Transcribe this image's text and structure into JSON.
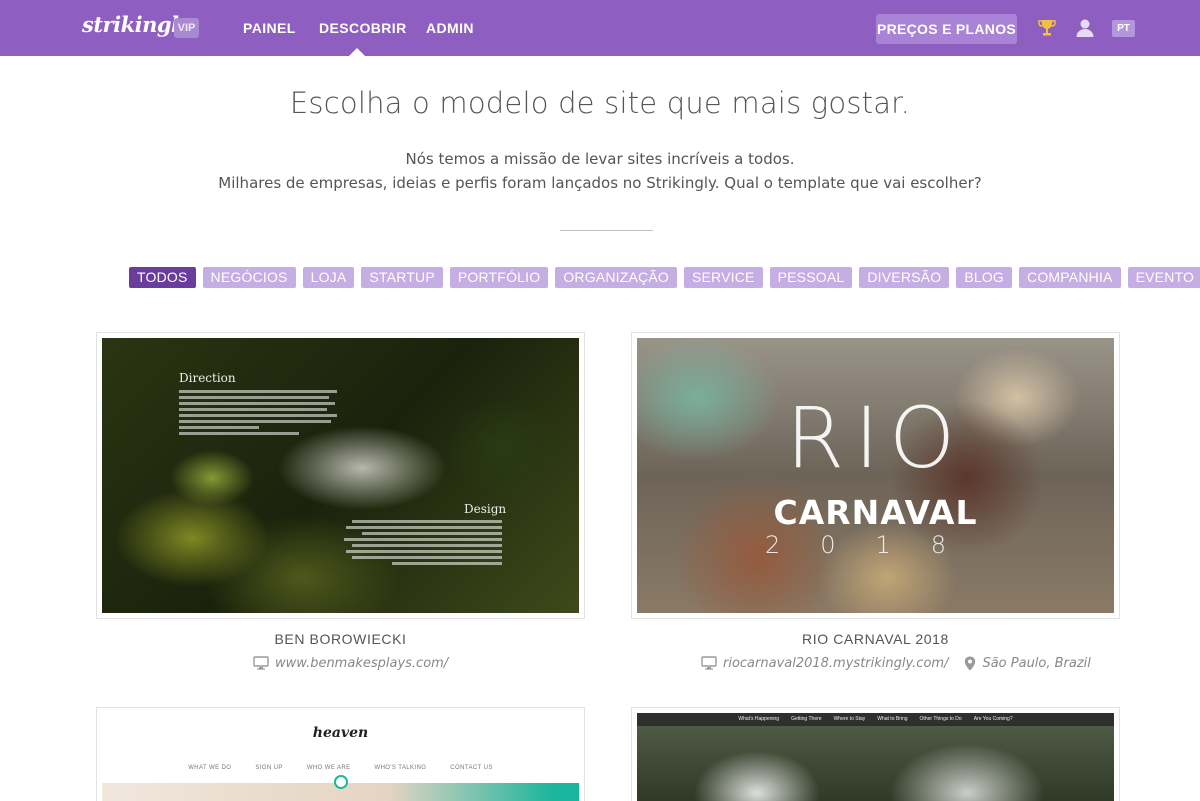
{
  "nav": {
    "logo": "strikingly",
    "vip": "VIP",
    "links": [
      "PAINEL",
      "DESCOBRIR",
      "ADMIN"
    ],
    "active_link": "DESCOBRIR",
    "plans_button": "PREÇOS E PLANOS",
    "trophy_icon": "trophy-icon",
    "user_icon": "user-icon",
    "lang": "PT",
    "trophy_color": "#f3c33c"
  },
  "hero": {
    "headline": "Escolha o modelo de site que mais gostar.",
    "sub_line_1": "Nós temos a missão de levar sites incríveis a todos.",
    "sub_line_2": "Milhares de empresas, ideias e perfis foram lançados no Strikingly. Qual o template que vai escolher?"
  },
  "filters": {
    "items": [
      "TODOS",
      "NEGÓCIOS",
      "LOJA",
      "STARTUP",
      "PORTFÓLIO",
      "ORGANIZAÇÃO",
      "SERVICE",
      "PESSOAL",
      "DIVERSÃO",
      "BLOG",
      "COMPANHIA",
      "EVENTO"
    ],
    "active": "TODOS"
  },
  "cards": [
    {
      "title": "BEN BOROWIECKI",
      "url": "www.benmakesplays.com/",
      "thumb_heading_1": "Direction",
      "thumb_heading_2": "Design"
    },
    {
      "title": "RIO CARNAVAL 2018",
      "url": "riocarnaval2018.mystrikingly.com/",
      "location": "São Paulo, Brazil",
      "thumb_word_1": "RIO",
      "thumb_word_2": "CARNAVAL",
      "thumb_year": "2018"
    },
    {
      "thumb_logo": "heaven",
      "thumb_nav": [
        "WHAT WE DO",
        "SIGN UP",
        "WHO WE ARE",
        "WHO'S TALKING",
        "CONTACT US"
      ]
    },
    {
      "thumb_nav": [
        "What's Happening",
        "Getting There",
        "Where to Stay",
        "What to Bring",
        "Other Things to Do",
        "Are You Coming?"
      ]
    }
  ],
  "colors": {
    "nav_bg": "#8e5fc0",
    "filter_bg": "#c5aee4",
    "filter_active_bg": "#6a3c9c"
  }
}
